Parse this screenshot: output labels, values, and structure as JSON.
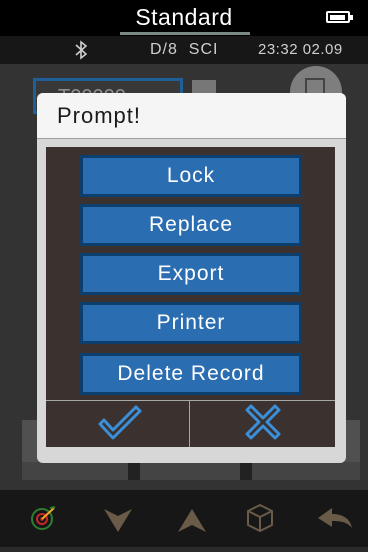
{
  "header": {
    "title": "Standard",
    "battery_icon": "battery-icon"
  },
  "status": {
    "bluetooth_icon": "bluetooth-icon",
    "mode": "D/8  SCI",
    "time": "23:32 02.09"
  },
  "background": {
    "field_text": "T00000"
  },
  "dialog": {
    "title": "Prompt!",
    "buttons": [
      {
        "label": "Lock"
      },
      {
        "label": "Replace"
      },
      {
        "label": "Export"
      },
      {
        "label": "Printer"
      },
      {
        "label": "Delete Record"
      }
    ],
    "confirm_icon": "checkmark-icon",
    "cancel_icon": "close-x-icon"
  },
  "toolbar": {
    "items": [
      {
        "icon": "target-measure-icon"
      },
      {
        "icon": "arrow-down-icon"
      },
      {
        "icon": "arrow-up-icon"
      },
      {
        "icon": "cube-icon"
      },
      {
        "icon": "back-arrow-icon"
      }
    ]
  },
  "colors": {
    "button_blue": "#2a6db0",
    "button_border": "#0c3f6e",
    "icon_blue": "#3a8fd8",
    "toolbar_icon": "#6a5a48",
    "dialog_body": "#3b312e"
  }
}
